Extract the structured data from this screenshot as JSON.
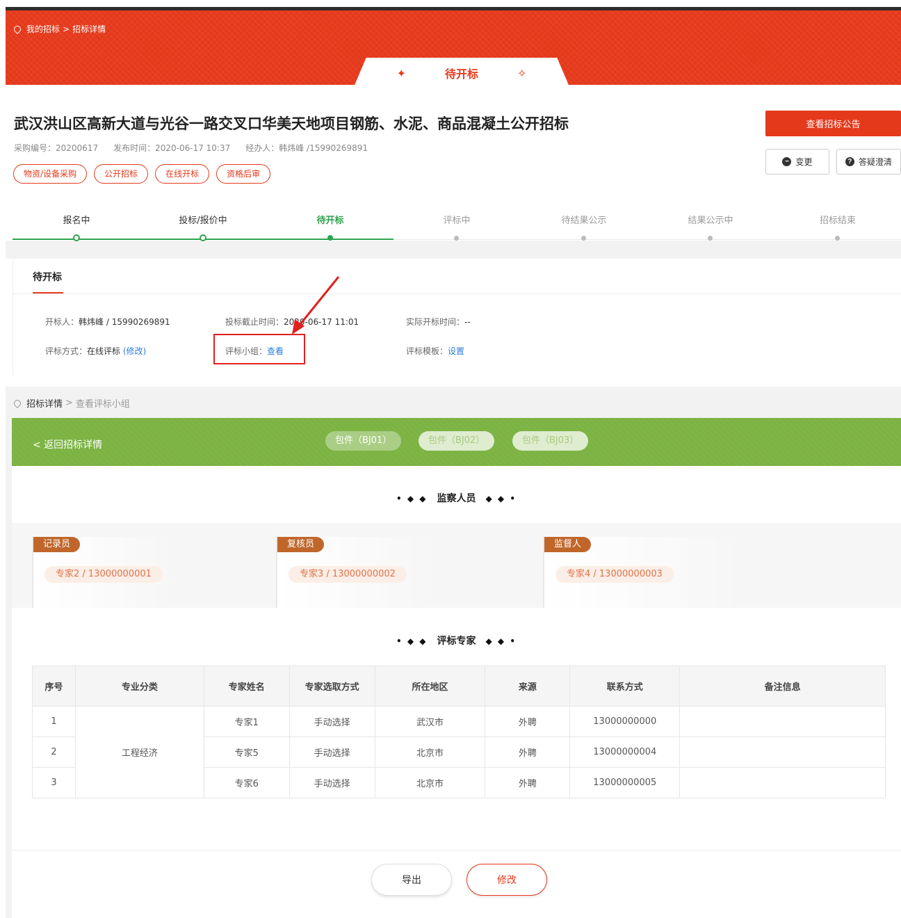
{
  "breadcrumb_top": {
    "item1": "我的招标",
    "sep": ">",
    "item2": "招标详情"
  },
  "status_tab": {
    "label": "待开标"
  },
  "project": {
    "title": "武汉洪山区高新大道与光谷一路交叉口华美天地项目钢筋、水泥、商品混凝土公开招标",
    "purchase_no": "采购编号：20200617",
    "publish_time": "发布时间：2020-06-17 10:37",
    "handler": "经办人：韩炜峰 /15990269891",
    "tags": [
      "物资/设备采购",
      "公开招标",
      "在线开标",
      "资格后审"
    ]
  },
  "actions": {
    "view_notice": "查看招标公告",
    "change": "变更",
    "qa": "答疑澄清"
  },
  "steps": [
    {
      "label": "报名中",
      "state": "done"
    },
    {
      "label": "投标/报价中",
      "state": "done"
    },
    {
      "label": "待开标",
      "state": "active"
    },
    {
      "label": "评标中",
      "state": "todo"
    },
    {
      "label": "待结果公示",
      "state": "todo"
    },
    {
      "label": "结果公示中",
      "state": "todo"
    },
    {
      "label": "招标结束",
      "state": "todo"
    }
  ],
  "card": {
    "title": "待开标",
    "opener_label": "开标人：",
    "opener_value": "韩炜峰 / 15990269891",
    "deadline_label": "投标截止时间：",
    "deadline_value": "2020-06-17 11:01",
    "actual_label": "实际开标时间：",
    "actual_value": "--",
    "method_label": "评标方式：",
    "method_value": "在线评标",
    "method_link": "(修改)",
    "group_label": "评标小组：",
    "group_link": "查看",
    "template_label": "评标模板：",
    "template_link": "设置"
  },
  "breadcrumb_lower": {
    "item1": "招标详情",
    "sep": ">",
    "item2": "查看评标小组"
  },
  "green_bar": {
    "back": "< 返回招标详情",
    "packages": [
      "包件（BJ01）",
      "包件（BJ02）",
      "包件（BJ03）"
    ]
  },
  "supervision": {
    "title": "监察人员",
    "roles": [
      {
        "role": "记录员",
        "person": "专家2 / 13000000001"
      },
      {
        "role": "复核员",
        "person": "专家3 / 13000000002"
      },
      {
        "role": "监督人",
        "person": "专家4 / 13000000003"
      }
    ]
  },
  "experts": {
    "title": "评标专家",
    "headers": [
      "序号",
      "专业分类",
      "专家姓名",
      "专家选取方式",
      "所在地区",
      "来源",
      "联系方式",
      "备注信息"
    ],
    "category": "工程经济",
    "rows": [
      {
        "no": "1",
        "name": "专家1",
        "method": "手动选择",
        "region": "武汉市",
        "source": "外聘",
        "phone": "13000000000",
        "note": ""
      },
      {
        "no": "2",
        "name": "专家5",
        "method": "手动选择",
        "region": "北京市",
        "source": "外聘",
        "phone": "13000000004",
        "note": ""
      },
      {
        "no": "3",
        "name": "专家6",
        "method": "手动选择",
        "region": "北京市",
        "source": "外聘",
        "phone": "13000000005",
        "note": ""
      }
    ]
  },
  "footer": {
    "export": "导出",
    "edit": "修改"
  },
  "colors": {
    "brand_red": "#e5391b",
    "green": "#7cb342",
    "step_green": "#2da44e",
    "link_blue": "#2a7de1"
  }
}
